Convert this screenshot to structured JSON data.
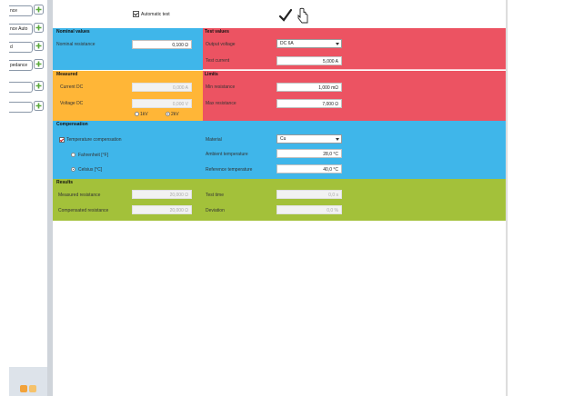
{
  "left_panel": {
    "items": [
      {
        "label": "nce"
      },
      {
        "label": "nce Auto"
      },
      {
        "label": "d"
      },
      {
        "label": "pedance"
      },
      {
        "label": ""
      },
      {
        "label": ""
      }
    ]
  },
  "toolbar": {
    "auto_test_label": "Automatic test"
  },
  "nominal": {
    "title": "Nominal values",
    "resistance_label": "Nominal resistance",
    "resistance_value": "0,100 Ω"
  },
  "test_values": {
    "title": "Test values",
    "output_label": "Output voltage",
    "output_value": "DC 6A",
    "current_label": "Test current",
    "current_value": "5,000 A"
  },
  "measured": {
    "title": "Measured",
    "current_label": "Current DC",
    "current_value": "0,000 A",
    "voltage_label": "Voltage DC",
    "voltage_value": "0,000 V",
    "radio1": "1kV",
    "radio2": "2kV"
  },
  "limits": {
    "title": "Limits",
    "min_label": "Min resistance",
    "min_value": "1,000 mΩ",
    "max_label": "Max resistance",
    "max_value": "7,000 Ω"
  },
  "compensation": {
    "title": "Compensation",
    "temp_comp_label": "Temperature compensation",
    "fahrenheit_label": "Fahrenheit [°F]",
    "celsius_label": "Celsius [°C]",
    "material_label": "Material",
    "material_value": "Cu",
    "ambient_label": "Ambient temperature",
    "ambient_value": "28,0 °C",
    "reference_label": "Reference temperature",
    "reference_value": "40,0 °C"
  },
  "results": {
    "title": "Results",
    "measured_res_label": "Measured resistance",
    "measured_res_value": "20,000 Ω",
    "compensated_label": "Compensated resistance",
    "compensated_value": "20,000 Ω",
    "test_time_label": "Test time",
    "test_time_value": "0,0 s",
    "deviation_label": "Deviation",
    "deviation_value": "0,0 %"
  },
  "colors": {
    "blue": "#3fb6ea",
    "red": "#ec5362",
    "orange": "#ffb637",
    "green": "#a3c13a"
  }
}
